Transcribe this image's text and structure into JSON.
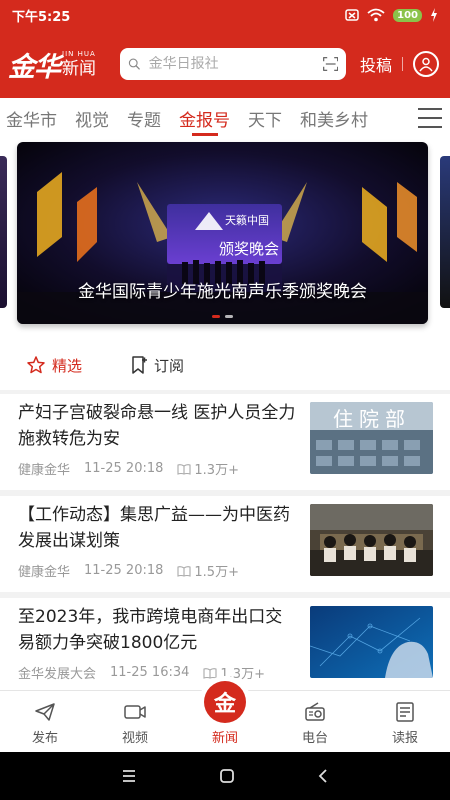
{
  "status_bar": {
    "time": "下午5:25",
    "battery": "100"
  },
  "header": {
    "logo_main": "金华",
    "logo_en": "JIN HUA",
    "logo_sub": "新闻",
    "search_placeholder": "金华日报社",
    "submit_label": "投稿"
  },
  "channels": {
    "tabs": [
      {
        "label": "金华市",
        "active": false
      },
      {
        "label": "视觉",
        "active": false
      },
      {
        "label": "专题",
        "active": false
      },
      {
        "label": "金报号",
        "active": true
      },
      {
        "label": "天下",
        "active": false
      },
      {
        "label": "和美乡村",
        "active": false
      }
    ]
  },
  "carousel": {
    "caption": "金华国际青少年施光南声乐季颁奖晚会",
    "screen_text": "颁奖晚会",
    "screen_brand": "天籁中国",
    "slide_count": 2,
    "active_index": 0
  },
  "sub_tabs": {
    "featured": "精选",
    "subscribe": "订阅"
  },
  "news": [
    {
      "title": "产妇子宫破裂命悬一线  医护人员全力施救转危为安",
      "source": "健康金华",
      "time": "11-25  20:18",
      "views": "1.3万+",
      "thumb_text": "住院部"
    },
    {
      "title": "【工作动态】集思广益——为中医药发展出谋划策",
      "source": "健康金华",
      "time": "11-25  20:18",
      "views": "1.5万+",
      "thumb_text": ""
    },
    {
      "title": "至2023年，我市跨境电商年出口交易额力争突破1800亿元",
      "source": "金华发展大会",
      "time": "11-25  16:34",
      "views": "1.3万+",
      "thumb_text": ""
    }
  ],
  "tab_bar": {
    "publish": "发布",
    "video": "视频",
    "news": "新闻",
    "center_glyph": "金",
    "radio": "电台",
    "paper": "读报"
  },
  "colors": {
    "brand": "#d42a1d"
  }
}
